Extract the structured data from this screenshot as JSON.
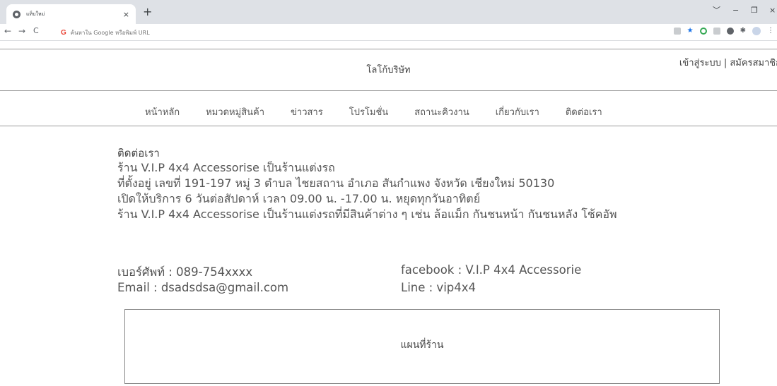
{
  "browser": {
    "tab_title": "แท็บใหม่",
    "tab_close": "×",
    "new_tab": "+",
    "window_controls": [
      "﹀",
      "−",
      "❐",
      "×"
    ],
    "nav": [
      "←",
      "→",
      "C"
    ],
    "omnibox_placeholder": "ค้นหาใน Google หรือพิมพ์ URL",
    "google_icon": "G"
  },
  "header": {
    "logo_text": "โลโก้บริษัท",
    "login": "เข้าสู่ระบบ",
    "separator": "|",
    "register": "สมัครสมาชิก"
  },
  "nav": {
    "items": [
      "หน้าหลัก",
      "หมวดหมู่สินค้า",
      "ข่าวสาร",
      "โปรโมชั่น",
      "สถานะคิวงาน",
      "เกี่ยวกับเรา",
      "ติดต่อเรา"
    ]
  },
  "contact": {
    "title": "ติดต่อเรา",
    "lines": [
      "ร้าน V.I.P 4x4 Accessorise เป็นร้านแต่งรถ",
      "ที่ตั้งอยู่ เลขที่ 191-197 หมู่ 3 ตำบล ไชยสถาน อำเภอ สันกำแพง จังหวัด เชียงใหม่ 50130",
      "เปิดให้บริการ 6 วันต่อสัปดาห์ เวลา 09.00 น. -17.00 น. หยุดทุกวันอาทิตย์",
      "ร้าน V.I.P 4x4 Accessorise เป็นร้านแต่งรถที่มีสินค้าต่าง ๆ เช่น ล้อแม็ก กันชนหน้า กันชนหลัง โช้คอัพ"
    ],
    "phone": "เบอร์ศัพท์ : 089-754xxxx",
    "email": "Email : dsadsdsa@gmail.com",
    "facebook": "facebook : V.I.P 4x4 Accessorie",
    "line": "Line : vip4x4"
  },
  "map": {
    "label": "แผนที่ร้าน"
  }
}
